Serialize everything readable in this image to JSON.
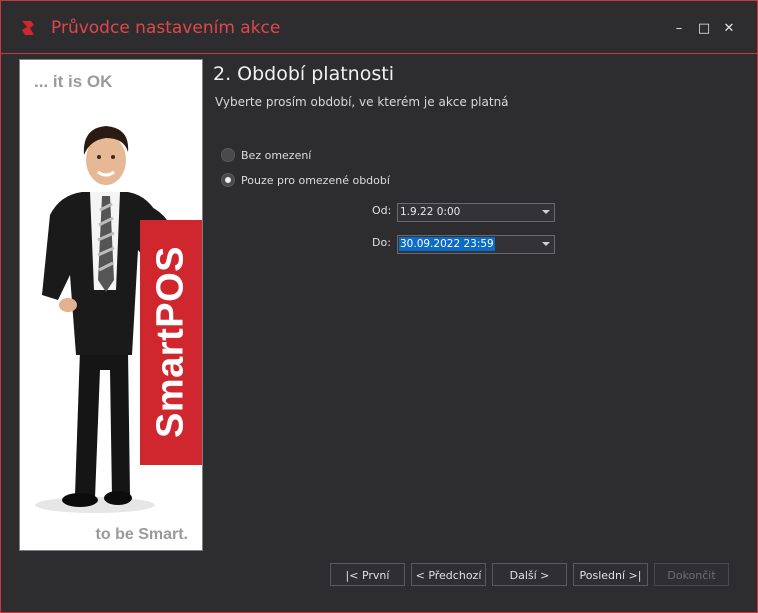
{
  "window": {
    "title": "Průvodce nastavením akce"
  },
  "controls": {
    "minimize": "–",
    "maximize": "□",
    "close": "✕"
  },
  "banner": {
    "tagline_top": "... it is OK",
    "tagline_bottom": "to be Smart.",
    "brand": "SmartPOS"
  },
  "step": {
    "title": "2. Období platnosti",
    "subtitle": "Vyberte prosím období, ve kterém je akce platná"
  },
  "options": [
    {
      "label": "Bez omezení",
      "checked": false
    },
    {
      "label": "Pouze pro omezené období",
      "checked": true
    }
  ],
  "fields": {
    "from": {
      "label": "Od:",
      "value": "1.9.22 0:00"
    },
    "to": {
      "label": "Do:",
      "value": "30.09.2022 23:59"
    }
  },
  "buttons": {
    "first": "|< První",
    "previous": "< Předchozí",
    "next": "Další >",
    "last": "Poslední >|",
    "finish": "Dokončit"
  },
  "colors": {
    "accent": "#c8393e",
    "background": "#2d2d30",
    "brand_red": "#d0262d",
    "selection": "#0a6bc8"
  }
}
